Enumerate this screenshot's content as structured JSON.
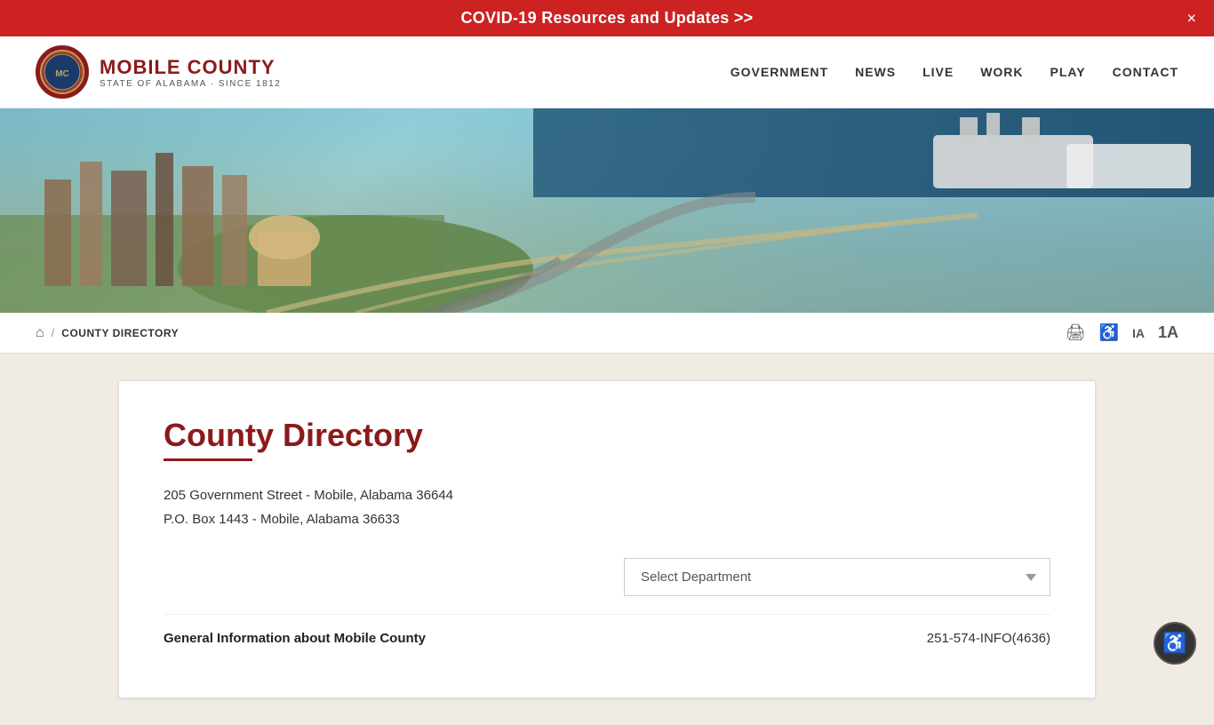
{
  "covid_banner": {
    "text": "COVID-19 Resources and Updates >>",
    "close_label": "×",
    "bg_color": "#cc2222"
  },
  "header": {
    "logo_icon": "🏛",
    "org_name": "MOBILE COUNTY",
    "org_subtitle": "STATE OF ALABAMA · SINCE 1812",
    "nav_items": [
      {
        "id": "government",
        "label": "GOVERNMENT"
      },
      {
        "id": "news",
        "label": "NEWS"
      },
      {
        "id": "live",
        "label": "LIVE"
      },
      {
        "id": "work",
        "label": "WORK"
      },
      {
        "id": "play",
        "label": "PLAY"
      },
      {
        "id": "contact",
        "label": "CONTACT"
      }
    ]
  },
  "breadcrumb": {
    "home_symbol": "⌂",
    "separator": "/",
    "current": "COUNTY DIRECTORY"
  },
  "toolbar": {
    "print_symbol": "🖨",
    "accessibility_symbol": "♿",
    "text_decrease_label": "IA",
    "text_increase_label": "1A"
  },
  "content": {
    "page_title": "County Directory",
    "address_line1": "205 Government Street - Mobile, Alabama 36644",
    "address_line2": "P.O. Box 1443 - Mobile, Alabama 36633",
    "select_placeholder": "Select Department",
    "directory_rows": [
      {
        "dept": "General Information about Mobile County",
        "phone": "251-574-INFO(4636)"
      }
    ]
  },
  "accessibility_btn_label": "♿"
}
